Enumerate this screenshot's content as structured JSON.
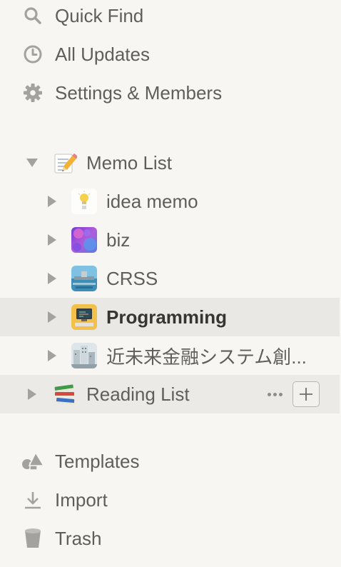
{
  "nav_top": [
    {
      "label": "Quick Find",
      "icon": "search-icon"
    },
    {
      "label": "All Updates",
      "icon": "clock-icon"
    },
    {
      "label": "Settings & Members",
      "icon": "gear-icon"
    }
  ],
  "workspace": {
    "memo_list": {
      "label": "Memo List",
      "icon": "memo-pencil-icon",
      "expanded": true,
      "children": [
        {
          "label": "idea memo",
          "icon": "lightbulb-icon"
        },
        {
          "label": "biz",
          "icon": "purple-abstract-icon"
        },
        {
          "label": "CRSS",
          "icon": "landscape-photo-icon"
        },
        {
          "label": "Programming",
          "icon": "computer-photo-icon",
          "selected": true
        },
        {
          "label": "近未来金融システム創...",
          "icon": "building-photo-icon"
        }
      ]
    },
    "reading_list": {
      "label": "Reading List",
      "icon": "books-icon",
      "expanded": false
    }
  },
  "nav_bottom": [
    {
      "label": "Templates",
      "icon": "shapes-icon"
    },
    {
      "label": "Import",
      "icon": "download-icon"
    },
    {
      "label": "Trash",
      "icon": "trash-icon"
    }
  ],
  "colors": {
    "background": "#f7f6f3",
    "hover": "#e9e8e4",
    "text": "#5f5e5b",
    "icon": "#a3a29e"
  }
}
